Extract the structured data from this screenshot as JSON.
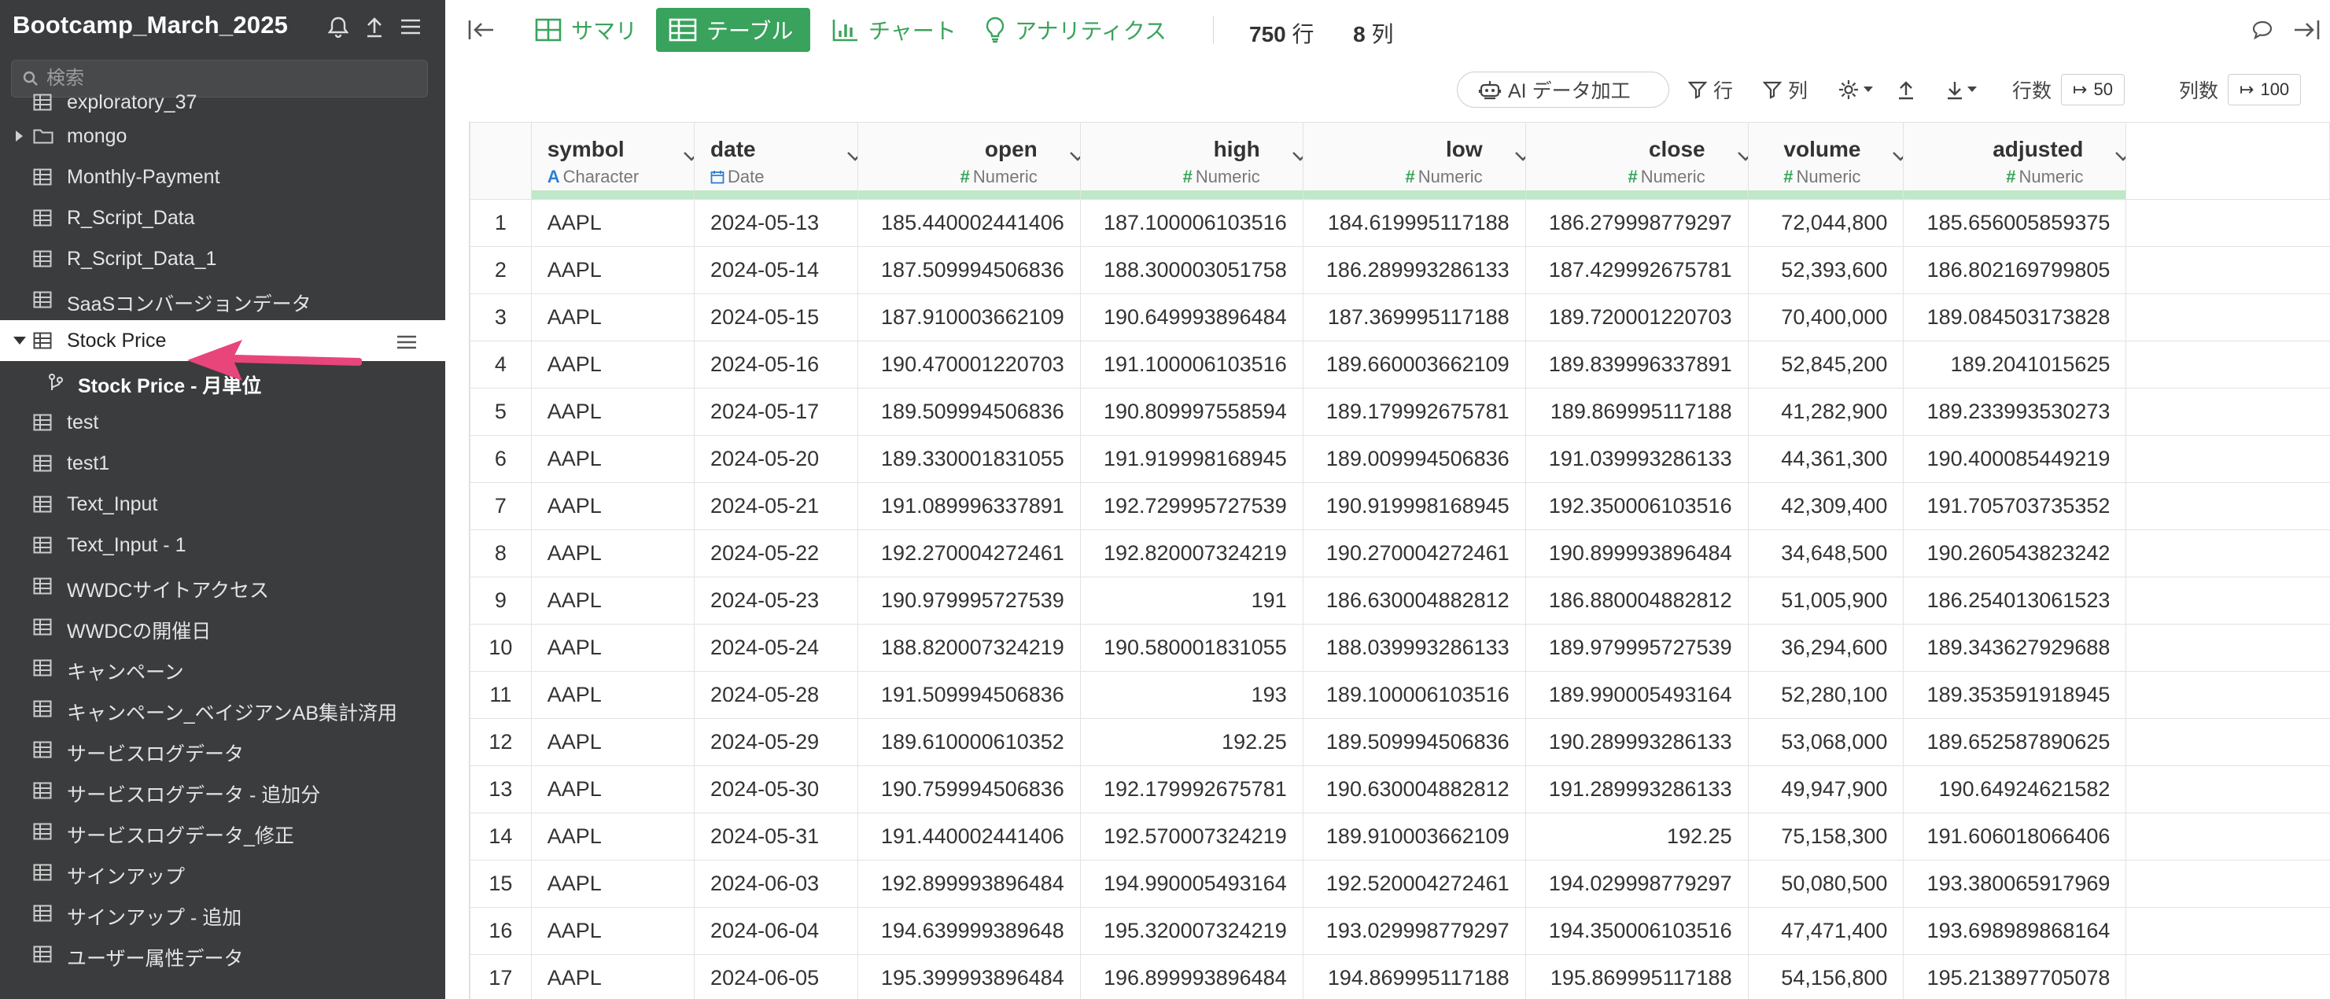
{
  "sidebar": {
    "project_title": "Bootcamp_March_2025",
    "search_placeholder": "検索",
    "items": [
      {
        "label": "exploratory_37",
        "icon": "table-icon"
      },
      {
        "label": "mongo",
        "icon": "folder-icon"
      },
      {
        "label": "Monthly-Payment",
        "icon": "table-icon"
      },
      {
        "label": "R_Script_Data",
        "icon": "table-icon"
      },
      {
        "label": "R_Script_Data_1",
        "icon": "table-icon"
      },
      {
        "label": "SaaSコンバージョンデータ",
        "icon": "table-icon"
      },
      {
        "label": "Stock Price",
        "icon": "table-icon"
      },
      {
        "label": "Stock Price - 月単位",
        "icon": "branch-icon"
      },
      {
        "label": "test",
        "icon": "table-icon"
      },
      {
        "label": "test1",
        "icon": "table-icon"
      },
      {
        "label": "Text_Input",
        "icon": "table-icon"
      },
      {
        "label": "Text_Input - 1",
        "icon": "table-icon"
      },
      {
        "label": "WWDCサイトアクセス",
        "icon": "table-icon"
      },
      {
        "label": "WWDCの開催日",
        "icon": "table-icon"
      },
      {
        "label": "キャンペーン",
        "icon": "table-icon"
      },
      {
        "label": "キャンペーン_ベイジアンAB集計済用",
        "icon": "table-icon"
      },
      {
        "label": "サービスログデータ",
        "icon": "table-icon"
      },
      {
        "label": "サービスログデータ - 追加分",
        "icon": "table-icon"
      },
      {
        "label": "サービスログデータ_修正",
        "icon": "table-icon"
      },
      {
        "label": "サインアップ",
        "icon": "table-icon"
      },
      {
        "label": "サインアップ - 追加",
        "icon": "table-icon"
      },
      {
        "label": "ユーザー属性データ",
        "icon": "table-icon"
      }
    ]
  },
  "toolbar": {
    "tabs": [
      {
        "label": "サマリ",
        "icon": "summary-grid-icon"
      },
      {
        "label": "テーブル",
        "icon": "table-icon"
      },
      {
        "label": "チャート",
        "icon": "bar-chart-icon"
      },
      {
        "label": "アナリティクス",
        "icon": "lightbulb-icon"
      }
    ],
    "rows_value": "750",
    "rows_unit": "行",
    "cols_value": "8",
    "cols_unit": "列"
  },
  "subbar": {
    "ai_label": "AI データ加工",
    "row_filter_label": "行",
    "col_filter_label": "列",
    "row_count_label": "行数",
    "row_count_value": "50",
    "col_count_label": "列数",
    "col_count_value": "100"
  },
  "table": {
    "columns": [
      {
        "name": "symbol",
        "type": "Character",
        "type_icon": "A"
      },
      {
        "name": "date",
        "type": "Date",
        "type_icon": "calendar-icon"
      },
      {
        "name": "open",
        "type": "Numeric",
        "type_icon": "#"
      },
      {
        "name": "high",
        "type": "Numeric",
        "type_icon": "#"
      },
      {
        "name": "low",
        "type": "Numeric",
        "type_icon": "#"
      },
      {
        "name": "close",
        "type": "Numeric",
        "type_icon": "#"
      },
      {
        "name": "volume",
        "type": "Numeric",
        "type_icon": "#"
      },
      {
        "name": "adjusted",
        "type": "Numeric",
        "type_icon": "#"
      }
    ],
    "rows": [
      [
        "1",
        "AAPL",
        "2024-05-13",
        "185.440002441406",
        "187.100006103516",
        "184.619995117188",
        "186.279998779297",
        "72,044,800",
        "185.656005859375"
      ],
      [
        "2",
        "AAPL",
        "2024-05-14",
        "187.509994506836",
        "188.300003051758",
        "186.289993286133",
        "187.429992675781",
        "52,393,600",
        "186.802169799805"
      ],
      [
        "3",
        "AAPL",
        "2024-05-15",
        "187.910003662109",
        "190.649993896484",
        "187.369995117188",
        "189.720001220703",
        "70,400,000",
        "189.084503173828"
      ],
      [
        "4",
        "AAPL",
        "2024-05-16",
        "190.470001220703",
        "191.100006103516",
        "189.660003662109",
        "189.839996337891",
        "52,845,200",
        "189.2041015625"
      ],
      [
        "5",
        "AAPL",
        "2024-05-17",
        "189.509994506836",
        "190.809997558594",
        "189.179992675781",
        "189.869995117188",
        "41,282,900",
        "189.233993530273"
      ],
      [
        "6",
        "AAPL",
        "2024-05-20",
        "189.330001831055",
        "191.919998168945",
        "189.009994506836",
        "191.039993286133",
        "44,361,300",
        "190.400085449219"
      ],
      [
        "7",
        "AAPL",
        "2024-05-21",
        "191.089996337891",
        "192.729995727539",
        "190.919998168945",
        "192.350006103516",
        "42,309,400",
        "191.705703735352"
      ],
      [
        "8",
        "AAPL",
        "2024-05-22",
        "192.270004272461",
        "192.820007324219",
        "190.270004272461",
        "190.899993896484",
        "34,648,500",
        "190.260543823242"
      ],
      [
        "9",
        "AAPL",
        "2024-05-23",
        "190.979995727539",
        "191",
        "186.630004882812",
        "186.880004882812",
        "51,005,900",
        "186.254013061523"
      ],
      [
        "10",
        "AAPL",
        "2024-05-24",
        "188.820007324219",
        "190.580001831055",
        "188.039993286133",
        "189.979995727539",
        "36,294,600",
        "189.343627929688"
      ],
      [
        "11",
        "AAPL",
        "2024-05-28",
        "191.509994506836",
        "193",
        "189.100006103516",
        "189.990005493164",
        "52,280,100",
        "189.353591918945"
      ],
      [
        "12",
        "AAPL",
        "2024-05-29",
        "189.610000610352",
        "192.25",
        "189.509994506836",
        "190.289993286133",
        "53,068,000",
        "189.652587890625"
      ],
      [
        "13",
        "AAPL",
        "2024-05-30",
        "190.759994506836",
        "192.179992675781",
        "190.630004882812",
        "191.289993286133",
        "49,947,900",
        "190.64924621582"
      ],
      [
        "14",
        "AAPL",
        "2024-05-31",
        "191.440002441406",
        "192.570007324219",
        "189.910003662109",
        "192.25",
        "75,158,300",
        "191.606018066406"
      ],
      [
        "15",
        "AAPL",
        "2024-06-03",
        "192.899993896484",
        "194.990005493164",
        "192.520004272461",
        "194.029998779297",
        "50,080,500",
        "193.380065917969"
      ],
      [
        "16",
        "AAPL",
        "2024-06-04",
        "194.639999389648",
        "195.320007324219",
        "193.029998779297",
        "194.350006103516",
        "47,471,400",
        "193.698989868164"
      ],
      [
        "17",
        "AAPL",
        "2024-06-05",
        "195.399993896484",
        "196.899993896484",
        "194.869995117188",
        "195.869995117188",
        "54,156,800",
        "195.213897705078"
      ]
    ]
  },
  "colors": {
    "accent_green": "#39a25c",
    "sidebar_bg": "#3a3c3e",
    "annotation_pink": "#e8457a",
    "type_char_blue": "#2c7fd1"
  }
}
